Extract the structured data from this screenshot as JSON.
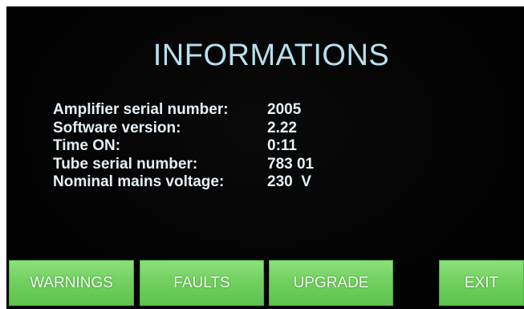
{
  "screen": {
    "title": "INFORMATIONS"
  },
  "info": {
    "rows": [
      {
        "label": "Amplifier serial number:",
        "value": "2005"
      },
      {
        "label": "Software version:",
        "value": "2.22"
      },
      {
        "label": "Time ON:",
        "value": "0:11"
      },
      {
        "label": "Tube serial number:",
        "value": "783 01"
      },
      {
        "label": "Nominal mains voltage:",
        "value": "230  V"
      }
    ]
  },
  "buttons": {
    "warnings": "WARNINGS",
    "faults": "FAULTS",
    "upgrade": "UPGRADE",
    "exit": "EXIT"
  },
  "colors": {
    "screen_background": "#000000",
    "title_text": "#b8e0ee",
    "info_text": "#e6f0f6",
    "button_green": "#72d05f"
  }
}
